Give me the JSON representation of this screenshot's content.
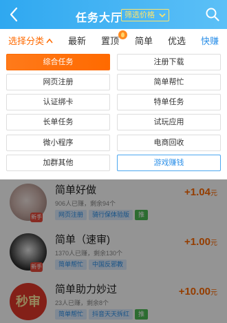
{
  "header": {
    "title": "任务大厅",
    "filter_label": "筛选价格"
  },
  "tabs": [
    {
      "label": "选择分类",
      "state": "active"
    },
    {
      "label": "最新"
    },
    {
      "label": "置顶"
    },
    {
      "label": "简单"
    },
    {
      "label": "优选"
    },
    {
      "label": "快赚",
      "state": "blue"
    }
  ],
  "categories": [
    {
      "label": "综合任务",
      "state": "selected"
    },
    {
      "label": "注册下载"
    },
    {
      "label": "网页注册"
    },
    {
      "label": "简单帮忙"
    },
    {
      "label": "认证绑卡"
    },
    {
      "label": "特单任务"
    },
    {
      "label": "长单任务"
    },
    {
      "label": "试玩应用"
    },
    {
      "label": "微小程序"
    },
    {
      "label": "电商回收"
    },
    {
      "label": "加群其他"
    },
    {
      "label": "游戏赚钱",
      "state": "outlined"
    }
  ],
  "tasks": [
    {
      "title": "简单好做",
      "sub": "906人已赚，剩余94个",
      "tags": [
        "网页注册",
        "骑行保体验版"
      ],
      "badge": "推",
      "price": "+1.04",
      "unit": "元",
      "newbie": "新手"
    },
    {
      "title": "简单（速审)",
      "sub": "1370人已赚，剩余130个",
      "tags": [
        "简单帮忙",
        "中国反邪教"
      ],
      "price": "+1.00",
      "unit": "元",
      "newbie": "新手"
    },
    {
      "title": "简单助力妙过",
      "sub": "23人已赚，剩余8个",
      "tags": [
        "简单帮忙",
        "抖音天天拆红"
      ],
      "badge": "推",
      "price": "+10.00",
      "unit": "元",
      "avatar_text": "秒审"
    }
  ],
  "colors": {
    "header_start": "#2fa8f0",
    "header_end": "#5cc0f7",
    "accent": "#ff6a00",
    "link_blue": "#2b8fe8",
    "filter_yellow": "#ffe46a"
  }
}
